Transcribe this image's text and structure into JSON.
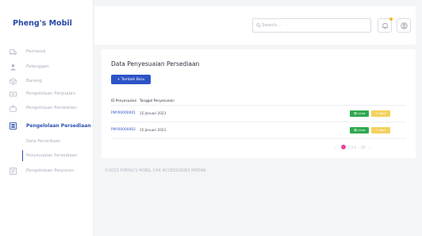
{
  "brand": "Pheng's Mobil",
  "sidebar": {
    "items": [
      {
        "label": "Pemasok",
        "icon": "truck-icon"
      },
      {
        "label": "Pelanggan",
        "icon": "user-icon"
      },
      {
        "label": "Barang",
        "icon": "box-icon"
      },
      {
        "label": "Pengelolaan Penjualan",
        "icon": "cash-icon"
      },
      {
        "label": "Pengelolaan Pembelian",
        "icon": "bag-icon"
      },
      {
        "label": "Pengelolaan Persediaan",
        "icon": "inventory-icon"
      },
      {
        "label": "Pengelolaan Perporan",
        "icon": "report-icon"
      }
    ],
    "subitems": [
      {
        "label": "Data Persediaan"
      },
      {
        "label": "Penyesuaian Persediaan"
      }
    ]
  },
  "header": {
    "search_placeholder": "Search..."
  },
  "main": {
    "title": "Data Penyesuaian Persediaan",
    "add_button": "+ Tambah Baru",
    "columns": [
      "ID Penyesuaian",
      "Tanggal Penyesuaian"
    ],
    "rows": [
      {
        "id": "PNY00000001",
        "date": "15 Januari 2023",
        "view": "Lihat",
        "edit": "Ubah"
      },
      {
        "id": "PNY00000002",
        "date": "15 Januari 2023",
        "view": "Lihat",
        "edit": "Ubah"
      }
    ],
    "pagination": {
      "prev": "‹",
      "pages": "2  3  4  ...  25",
      "next": "›"
    }
  },
  "footer": "©2023 PHENG'S MOBIL CAR ACCESSORIES MEDAN",
  "colors": {
    "accent": "#2c54c6",
    "view": "#2fa84f",
    "edit": "#f4d15d",
    "notification": "#f6b51e"
  }
}
